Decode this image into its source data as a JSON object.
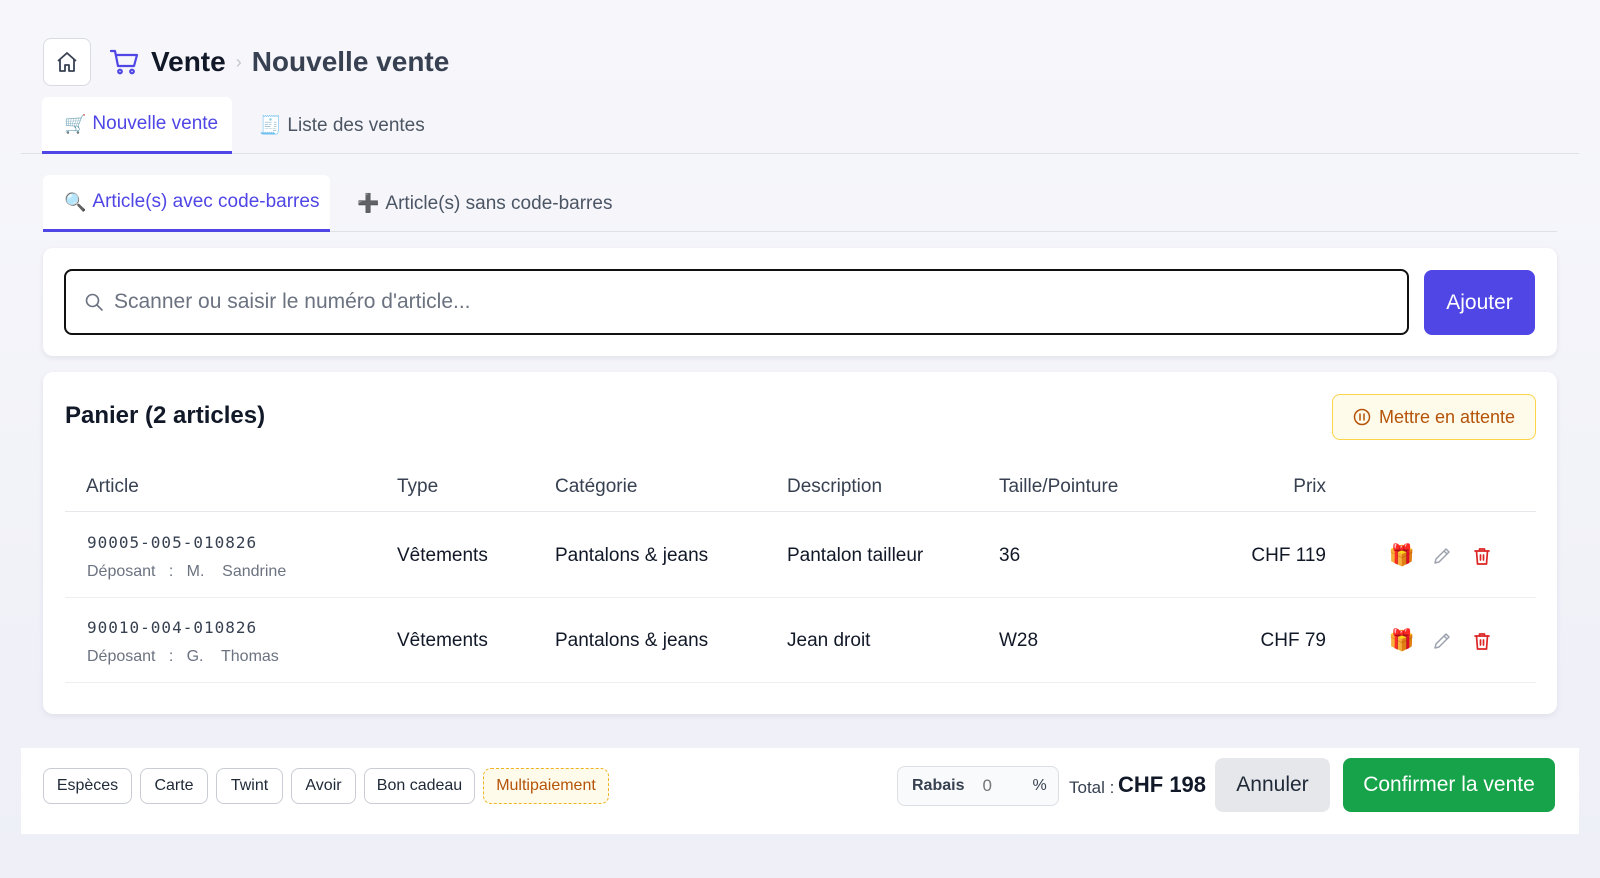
{
  "header": {
    "title": "Vente",
    "separator": "›",
    "subtitle": "Nouvelle vente"
  },
  "main_tabs": [
    {
      "icon": "🛒",
      "label": "Nouvelle vente",
      "active": true
    },
    {
      "icon": "🧾",
      "label": "Liste des ventes",
      "active": false
    }
  ],
  "sub_tabs": [
    {
      "icon": "🔍",
      "label": "Article(s) avec code-barres",
      "active": true
    },
    {
      "icon": "➕",
      "label": "Article(s) sans code-barres",
      "active": false
    }
  ],
  "scan": {
    "placeholder": "Scanner ou saisir le numéro d'article...",
    "value": "",
    "button": "Ajouter"
  },
  "cart": {
    "title": "Panier (2 articles)",
    "hold_button": "Mettre en attente",
    "columns": [
      "Article",
      "Type",
      "Catégorie",
      "Description",
      "Taille/Pointure",
      "Prix"
    ],
    "rows": [
      {
        "code": "90005-005-010826",
        "depositor": "Déposant   :   M.    Sandrine",
        "type": "Vêtements",
        "category": "Pantalons & jeans",
        "description": "Pantalon tailleur",
        "size": "36",
        "price": "CHF 119"
      },
      {
        "code": "90010-004-010826",
        "depositor": "Déposant   :   G.    Thomas",
        "type": "Vêtements",
        "category": "Pantalons & jeans",
        "description": "Jean droit",
        "size": "W28",
        "price": "CHF 79"
      }
    ]
  },
  "payment_methods": [
    {
      "label": "Espèces"
    },
    {
      "label": "Carte"
    },
    {
      "label": "Twint"
    },
    {
      "label": "Avoir"
    },
    {
      "label": "Bon cadeau"
    },
    {
      "label": "Multipaiement",
      "highlighted": true
    }
  ],
  "discount": {
    "label": "Rabais",
    "placeholder": "0",
    "unit": "%"
  },
  "total": {
    "label": "Total :",
    "value": "CHF 198"
  },
  "actions": {
    "cancel": "Annuler",
    "confirm": "Confirmer la vente"
  },
  "colors": {
    "accent": "#4f46e5",
    "confirm": "#16a34a",
    "danger": "#dc2626",
    "warning": "#b45309"
  }
}
